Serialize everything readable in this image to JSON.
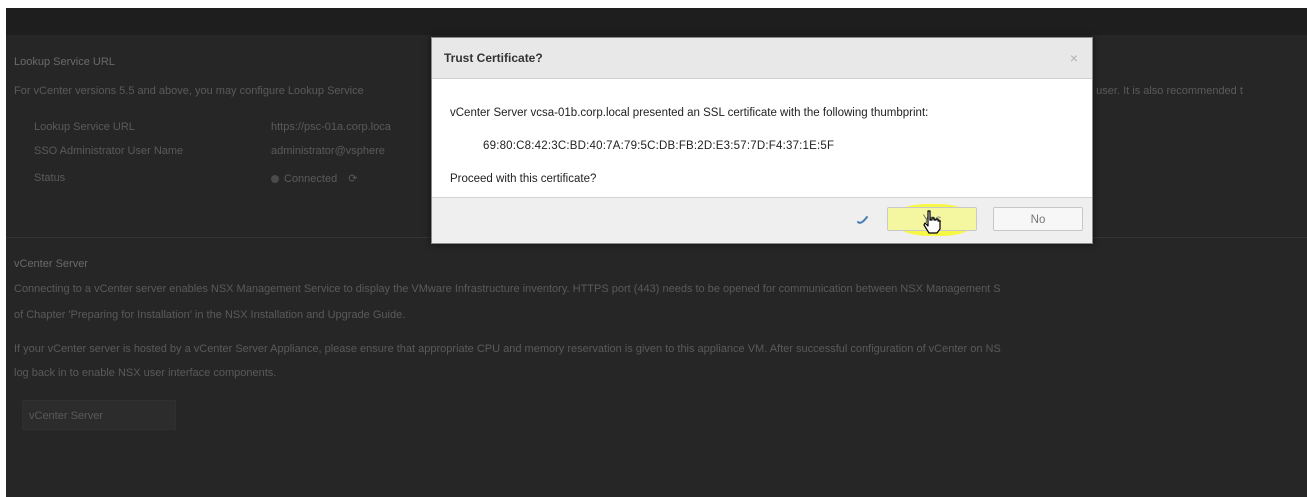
{
  "background": {
    "lookup_section_title": "Lookup Service URL",
    "lookup_description": "For vCenter versions 5.5 and above, you may configure Lookup Service",
    "lookup_description_tail": "h user. It is also recommended t",
    "fields": [
      {
        "label": "Lookup Service URL",
        "value": "https://psc-01a.corp.loca"
      },
      {
        "label": "SSO Administrator User Name",
        "value": "administrator@vsphere"
      },
      {
        "label": "Status",
        "value": "Connected"
      }
    ],
    "vcenter_section_title": "vCenter Server",
    "vcenter_para1_line1": "Connecting to a vCenter server enables NSX Management Service to display the VMware Infrastructure inventory. HTTPS port (443) needs to be opened for communication between NSX Management S",
    "vcenter_para1_line2": "of Chapter 'Preparing for Installation' in the NSX Installation and Upgrade Guide.",
    "vcenter_para2_line1": "If your vCenter server is hosted by a vCenter Server Appliance, please ensure that appropriate CPU and memory reservation is given to this appliance VM. After successful configuration of vCenter on NS",
    "vcenter_para2_line2": "log back in to enable NSX user interface components.",
    "vcenter_button_label": "vCenter Server"
  },
  "dialog": {
    "title": "Trust Certificate?",
    "close_symbol": "×",
    "message": "vCenter Server vcsa-01b.corp.local presented an SSL certificate with the following thumbprint:",
    "thumbprint": "69:80:C8:42:3C:BD:40:7A:79:5C:DB:FB:2D:E3:57:7D:F4:37:1E:5F",
    "question": "Proceed with this certificate?",
    "yes_label": "Yes",
    "no_label": "No"
  },
  "colors": {
    "background": "#262626",
    "highlight": "#f7f73b",
    "dialog_header": "#e8e8e8"
  },
  "icons": {
    "close": "close-icon",
    "spinner": "loading-spinner-icon",
    "cursor": "hand-pointer-cursor-icon",
    "status_dot": "status-dot-icon",
    "refresh": "refresh-icon"
  }
}
